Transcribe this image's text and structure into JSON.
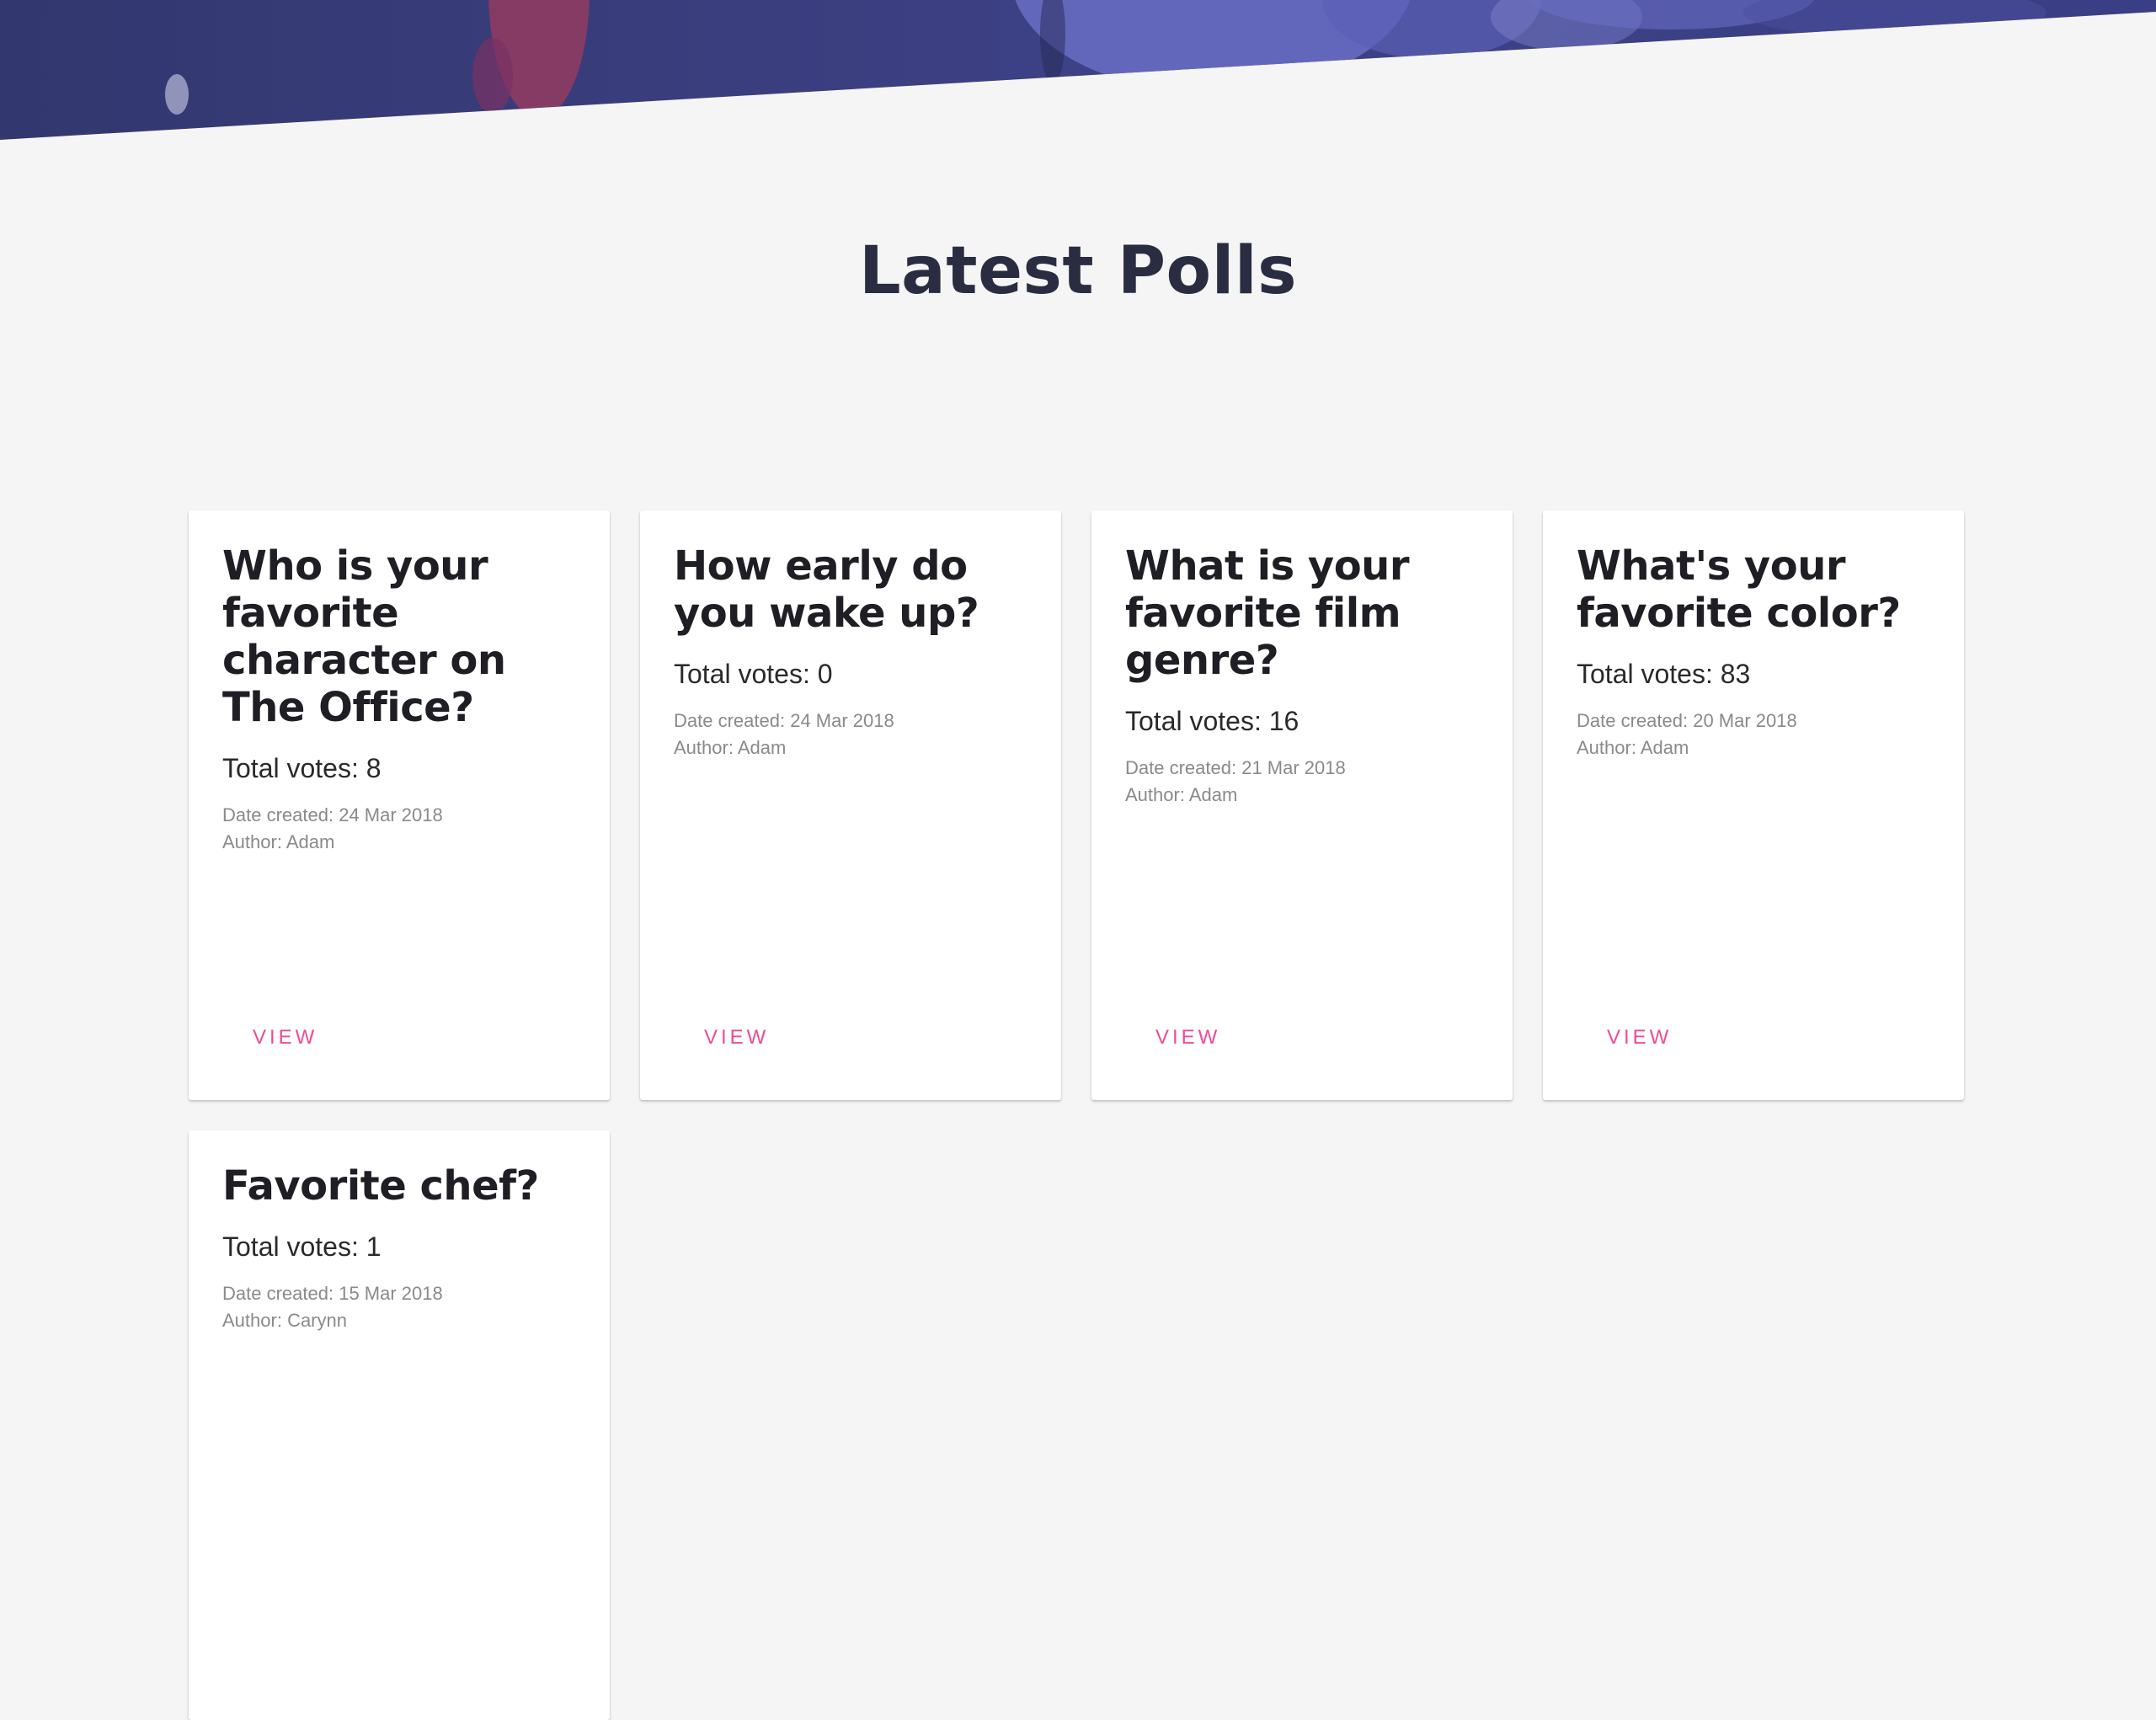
{
  "hero": {
    "colors": {
      "primary": "#3b3d86",
      "secondary": "#6a6fc6",
      "accent": "#d2364f"
    }
  },
  "section": {
    "title": "Latest Polls"
  },
  "labels": {
    "total_votes": "Total votes:",
    "date_created": "Date created:",
    "author": "Author:",
    "view": "VIEW"
  },
  "accent_color": "#ee4c96",
  "polls": [
    {
      "question": "Who is your favorite character on The Office?",
      "total_votes": "8",
      "date_created": "24 Mar 2018",
      "author": "Adam"
    },
    {
      "question": "How early do you wake up?",
      "total_votes": "0",
      "date_created": "24 Mar 2018",
      "author": "Adam"
    },
    {
      "question": "What is your favorite film genre?",
      "total_votes": "16",
      "date_created": "21 Mar 2018",
      "author": "Adam"
    },
    {
      "question": "What's your favorite color?",
      "total_votes": "83",
      "date_created": "20 Mar 2018",
      "author": "Adam"
    },
    {
      "question": "Favorite chef?",
      "total_votes": "1",
      "date_created": "15 Mar 2018",
      "author": "Carynn"
    }
  ]
}
